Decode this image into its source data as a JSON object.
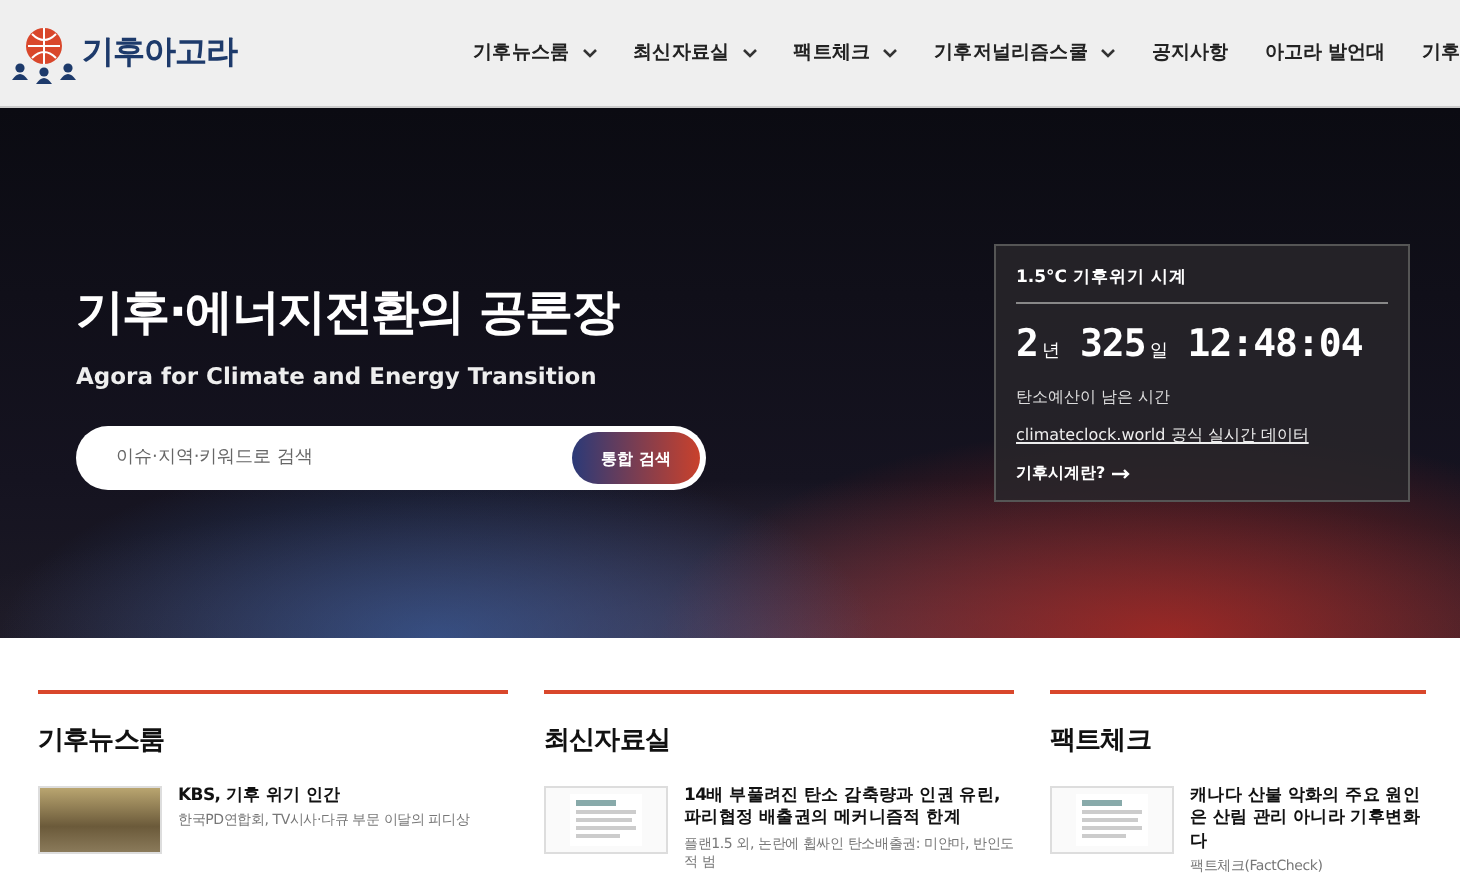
{
  "header": {
    "logo_text": "기후아고라",
    "nav": [
      {
        "label": "기후뉴스룸",
        "has_dropdown": true
      },
      {
        "label": "최신자료실",
        "has_dropdown": true
      },
      {
        "label": "팩트체크",
        "has_dropdown": true
      },
      {
        "label": "기후저널리즘스쿨",
        "has_dropdown": true
      },
      {
        "label": "공지사항",
        "has_dropdown": false
      },
      {
        "label": "아고라 발언대",
        "has_dropdown": false
      },
      {
        "label": "기후",
        "has_dropdown": false
      }
    ]
  },
  "hero": {
    "title": "기후·에너지전환의 공론장",
    "subtitle": "Agora for Climate and Energy Transition",
    "search": {
      "placeholder": "이슈·지역·키워드로 검색",
      "button": "통합 검색"
    },
    "clock": {
      "title": "1.5°C 기후위기 시계",
      "years": "2",
      "years_unit": "년",
      "days": "325",
      "days_unit": "일",
      "time": "12:48:04",
      "caption": "탄소예산이 남은 시간",
      "link": "climateclock.world 공식 실시간 데이터",
      "more": "기후시계란?"
    }
  },
  "sections": [
    {
      "heading": "기후뉴스룸",
      "items": [
        {
          "kind": "photo",
          "title": "KBS, 기후 위기 인간",
          "subtitle": "한국PD연합회, TV시사·다큐 부문 이달의 피디상"
        }
      ]
    },
    {
      "heading": "최신자료실",
      "items": [
        {
          "kind": "document",
          "title": "14배 부풀려진 탄소 감축량과 인권 유린, 파리협정 배출권의 메커니즘적 한계",
          "subtitle": "플랜1.5 외, 논란에 휩싸인 탄소배출권: 미얀마, 반인도적 범"
        }
      ]
    },
    {
      "heading": "팩트체크",
      "items": [
        {
          "kind": "document",
          "title": "캐나다 산불 악화의 주요 원인은 산림 관리 아니라 기후변화다",
          "subtitle": "팩트체크(FactCheck)"
        }
      ]
    }
  ]
}
